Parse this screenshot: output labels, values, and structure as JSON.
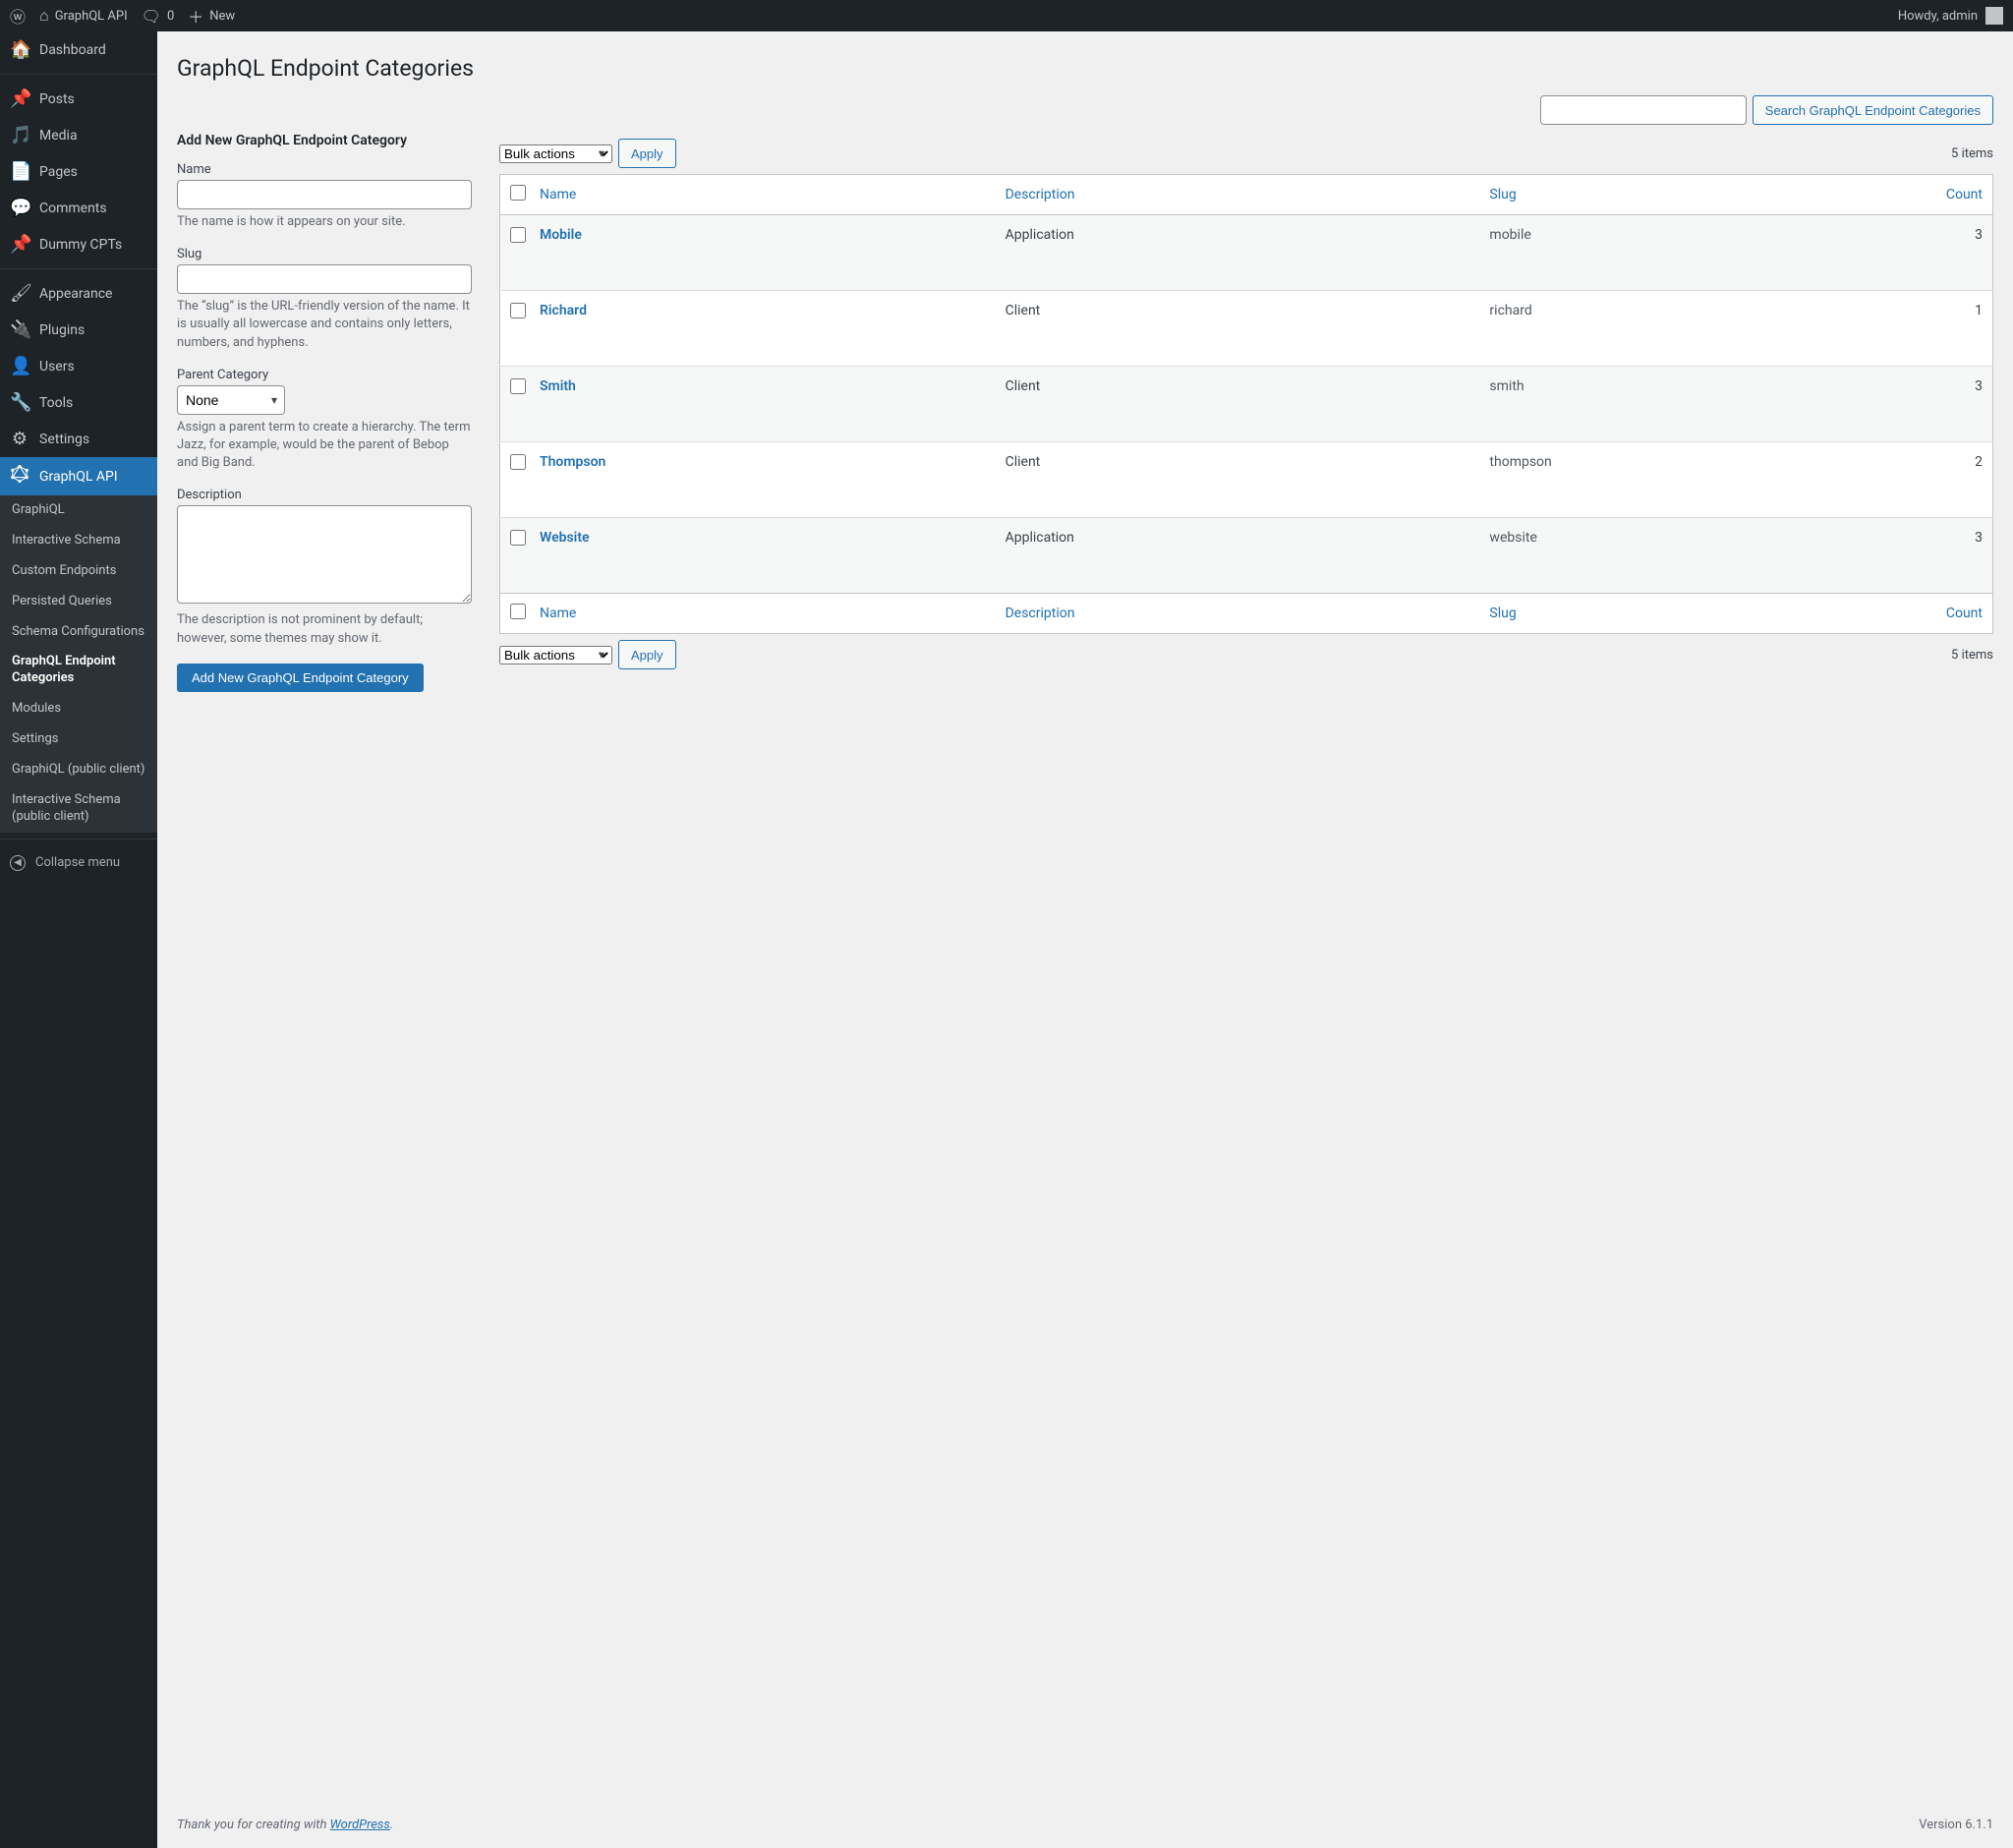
{
  "admin_bar": {
    "site_name": "GraphQL API",
    "comments_count": "0",
    "new_label": "New",
    "howdy": "Howdy, admin"
  },
  "sidebar": {
    "items": [
      {
        "label": "Dashboard",
        "icon": "◐"
      },
      {
        "label": "Posts",
        "icon": "📌"
      },
      {
        "label": "Media",
        "icon": "🎵"
      },
      {
        "label": "Pages",
        "icon": "📄"
      },
      {
        "label": "Comments",
        "icon": "💬"
      },
      {
        "label": "Dummy CPTs",
        "icon": "📌"
      },
      {
        "label": "Appearance",
        "icon": "🖌"
      },
      {
        "label": "Plugins",
        "icon": "🔌"
      },
      {
        "label": "Users",
        "icon": "👤"
      },
      {
        "label": "Tools",
        "icon": "🔧"
      },
      {
        "label": "Settings",
        "icon": "⚙"
      },
      {
        "label": "GraphQL API",
        "icon": "gql"
      }
    ],
    "submenu": [
      "GraphiQL",
      "Interactive Schema",
      "Custom Endpoints",
      "Persisted Queries",
      "Schema Configurations",
      "GraphQL Endpoint Categories",
      "Modules",
      "Settings",
      "GraphiQL (public client)",
      "Interactive Schema (public client)"
    ],
    "collapse": "Collapse menu"
  },
  "page": {
    "title": "GraphQL Endpoint Categories",
    "search_button": "Search GraphQL Endpoint Categories",
    "bulk_actions": "Bulk actions",
    "apply": "Apply",
    "items": "5 items"
  },
  "form": {
    "heading": "Add New GraphQL Endpoint Category",
    "name_label": "Name",
    "name_desc": "The name is how it appears on your site.",
    "slug_label": "Slug",
    "slug_desc": "The “slug” is the URL-friendly version of the name. It is usually all lowercase and contains only letters, numbers, and hyphens.",
    "parent_label": "Parent Category",
    "parent_value": "None",
    "parent_desc": "Assign a parent term to create a hierarchy. The term Jazz, for example, would be the parent of Bebop and Big Band.",
    "desc_label": "Description",
    "desc_desc": "The description is not prominent by default; however, some themes may show it.",
    "submit": "Add New GraphQL Endpoint Category"
  },
  "table": {
    "columns": {
      "name": "Name",
      "description": "Description",
      "slug": "Slug",
      "count": "Count"
    },
    "rows": [
      {
        "name": "Mobile",
        "description": "Application",
        "slug": "mobile",
        "count": "3"
      },
      {
        "name": "Richard",
        "description": "Client",
        "slug": "richard",
        "count": "1"
      },
      {
        "name": "Smith",
        "description": "Client",
        "slug": "smith",
        "count": "3"
      },
      {
        "name": "Thompson",
        "description": "Client",
        "slug": "thompson",
        "count": "2"
      },
      {
        "name": "Website",
        "description": "Application",
        "slug": "website",
        "count": "3"
      }
    ]
  },
  "footer": {
    "thanks_prefix": "Thank you for creating with ",
    "wp": "WordPress",
    "dot": ".",
    "version": "Version 6.1.1"
  }
}
